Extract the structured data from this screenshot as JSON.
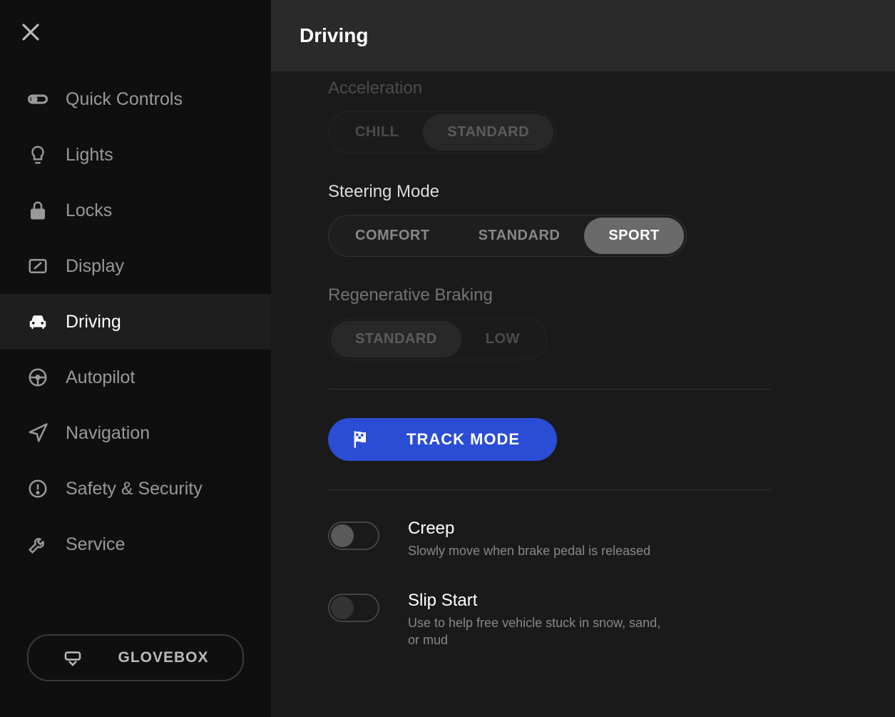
{
  "header": {
    "title": "Driving"
  },
  "sidebar": {
    "items": [
      {
        "label": "Quick Controls"
      },
      {
        "label": "Lights"
      },
      {
        "label": "Locks"
      },
      {
        "label": "Display"
      },
      {
        "label": "Driving"
      },
      {
        "label": "Autopilot"
      },
      {
        "label": "Navigation"
      },
      {
        "label": "Safety & Security"
      },
      {
        "label": "Service"
      }
    ],
    "glovebox": "GLOVEBOX"
  },
  "settings": {
    "acceleration": {
      "label": "Acceleration",
      "options": [
        "CHILL",
        "STANDARD"
      ],
      "selected": "STANDARD"
    },
    "steering": {
      "label": "Steering Mode",
      "options": [
        "COMFORT",
        "STANDARD",
        "SPORT"
      ],
      "selected": "SPORT"
    },
    "regen": {
      "label": "Regenerative Braking",
      "options": [
        "STANDARD",
        "LOW"
      ],
      "selected": "STANDARD"
    },
    "track_mode": "TRACK MODE",
    "creep": {
      "title": "Creep",
      "desc": "Slowly move when brake pedal is released",
      "enabled": false
    },
    "slip_start": {
      "title": "Slip Start",
      "desc": "Use to help free vehicle stuck in snow, sand, or mud",
      "enabled": false
    }
  }
}
